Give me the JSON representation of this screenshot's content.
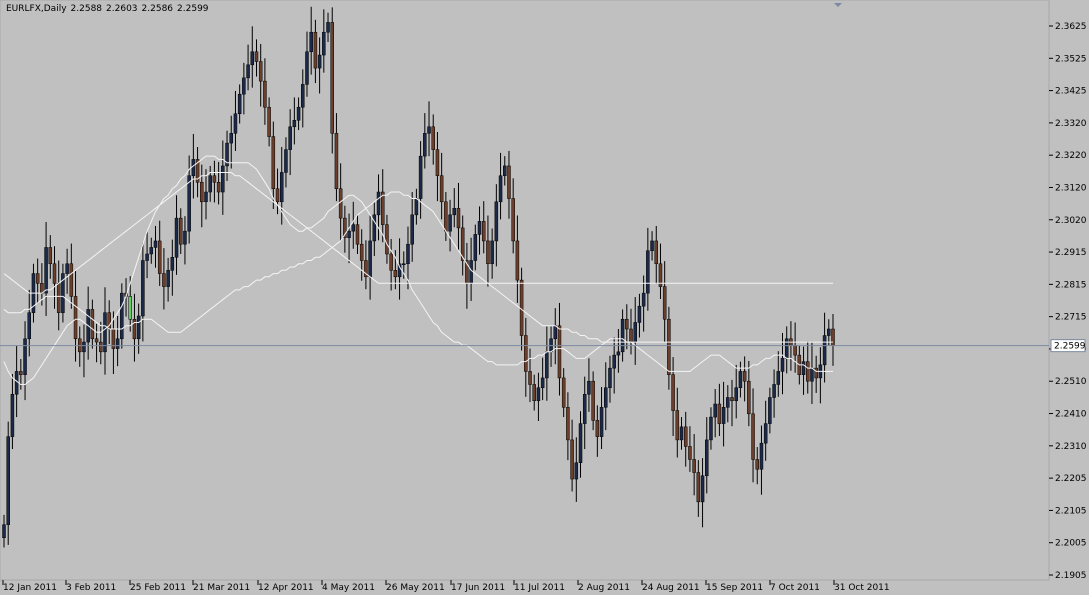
{
  "header": {
    "symbol": "EURLFX,Daily",
    "ohlc": [
      "2.2588",
      "2.2603",
      "2.2586",
      "2.2599"
    ]
  },
  "colors": {
    "background": "#c0c0c0",
    "bull_body": "#1c2a4a",
    "bear_body": "#6b3f2b",
    "wick": "#000000",
    "moving_average": "#f4f4f4",
    "price_line": "#7b8aa0",
    "highlight_candle": "#5ad45a"
  },
  "chart_data": {
    "type": "candlestick",
    "title": "EURLFX,Daily",
    "current_price": 2.2599,
    "current_price_label": "2.2599",
    "ylim": [
      2.1905,
      2.3625
    ],
    "y_ticks": [
      "2.3625",
      "2.3525",
      "2.3425",
      "2.3320",
      "2.3220",
      "2.3120",
      "2.3020",
      "2.2915",
      "2.2815",
      "2.2715",
      "2.2610",
      "2.2510",
      "2.2410",
      "2.2310",
      "2.2205",
      "2.2105",
      "2.2005",
      "2.1905"
    ],
    "x_ticks": [
      "12 Jan 2011",
      "3 Feb 2011",
      "25 Feb 2011",
      "21 Mar 2011",
      "12 Apr 2011",
      "4 May 2011",
      "26 May 2011",
      "17 Jun 2011",
      "11 Jul 2011",
      "2 Aug 2011",
      "24 Aug 2011",
      "15 Sep 2011",
      "7 Oct 2011",
      "31 Oct 2011"
    ],
    "grid": false,
    "closes": [
      2.205,
      2.232,
      2.245,
      2.252,
      2.251,
      2.262,
      2.27,
      2.282,
      2.279,
      2.276,
      2.29,
      2.285,
      2.279,
      2.27,
      2.282,
      2.285,
      2.275,
      2.262,
      2.258,
      2.261,
      2.271,
      2.262,
      2.261,
      2.258,
      2.27,
      2.265,
      2.259,
      2.262,
      2.276,
      2.275,
      2.268,
      2.262,
      2.269,
      2.286,
      2.288,
      2.29,
      2.292,
      2.282,
      2.278,
      2.283,
      2.287,
      2.299,
      2.291,
      2.295,
      2.312,
      2.317,
      2.31,
      2.304,
      2.307,
      2.312,
      2.31,
      2.307,
      2.315,
      2.322,
      2.325,
      2.331,
      2.337,
      2.342,
      2.346,
      2.35,
      2.347,
      2.341,
      2.333,
      2.324,
      2.308,
      2.304,
      2.313,
      2.32,
      2.327,
      2.329,
      2.333,
      2.34,
      2.35,
      2.356,
      2.345,
      2.349,
      2.356,
      2.359,
      2.325,
      2.308,
      2.299,
      2.293,
      2.295,
      2.297,
      2.291,
      2.286,
      2.281,
      2.292,
      2.3,
      2.307,
      2.297,
      2.288,
      2.283,
      2.281,
      2.285,
      2.285,
      2.291,
      2.3,
      2.305,
      2.318,
      2.325,
      2.327,
      2.32,
      2.312,
      2.304,
      2.295,
      2.3,
      2.302,
      2.296,
      2.286,
      2.279,
      2.286,
      2.294,
      2.298,
      2.292,
      2.285,
      2.292,
      2.304,
      2.312,
      2.315,
      2.305,
      2.292,
      2.28,
      2.263,
      2.252,
      2.248,
      2.243,
      2.247,
      2.25,
      2.258,
      2.262,
      2.266,
      2.25,
      2.241,
      2.231,
      2.219,
      2.224,
      2.236,
      2.245,
      2.249,
      2.237,
      2.232,
      2.241,
      2.247,
      2.253,
      2.257,
      2.258,
      2.268,
      2.265,
      2.261,
      2.267,
      2.272,
      2.276,
      2.289,
      2.292,
      2.285,
      2.278,
      2.268,
      2.251,
      2.24,
      2.231,
      2.235,
      2.229,
      2.225,
      2.221,
      2.212,
      2.22,
      2.231,
      2.238,
      2.242,
      2.236,
      2.241,
      2.244,
      2.243,
      2.247,
      2.252,
      2.249,
      2.239,
      2.225,
      2.222,
      2.23,
      2.236,
      2.244,
      2.248,
      2.252,
      2.256,
      2.262,
      2.26,
      2.257,
      2.251,
      2.255,
      2.249,
      2.253,
      2.25,
      2.254,
      2.263,
      2.265,
      2.2599
    ],
    "ma_fast": [
      2.255,
      2.252,
      2.25,
      2.249,
      2.248,
      2.248,
      2.249,
      2.25,
      2.252,
      2.254,
      2.256,
      2.258,
      2.26,
      2.262,
      2.264,
      2.266,
      2.267,
      2.268,
      2.268,
      2.267,
      2.266,
      2.265,
      2.264,
      2.264,
      2.265,
      2.266,
      2.268,
      2.27,
      2.272,
      2.275,
      2.279,
      2.283,
      2.287,
      2.291,
      2.295,
      2.298,
      2.301,
      2.303,
      2.305,
      2.306,
      2.308,
      2.309,
      2.311,
      2.312,
      2.314,
      2.315,
      2.316,
      2.317,
      2.318,
      2.318,
      2.318,
      2.317,
      2.317,
      2.316,
      2.316,
      2.316,
      2.316,
      2.316,
      2.316,
      2.315,
      2.314,
      2.312,
      2.31,
      2.308,
      2.305,
      2.303,
      2.301,
      2.299,
      2.297,
      2.296,
      2.295,
      2.295,
      2.296,
      2.296,
      2.297,
      2.298,
      2.299,
      2.301,
      2.302,
      2.303,
      2.304,
      2.305,
      2.306,
      2.306,
      2.305,
      2.304,
      2.302,
      2.3,
      2.298,
      2.296,
      2.294,
      2.291,
      2.289,
      2.287,
      2.284,
      2.282,
      2.28,
      2.277,
      2.275,
      2.273,
      2.271,
      2.269,
      2.267,
      2.266,
      2.264,
      2.263,
      2.262,
      2.261,
      2.261,
      2.26,
      2.26,
      2.259,
      2.258,
      2.257,
      2.256,
      2.255,
      2.255,
      2.254,
      2.254,
      2.254,
      2.254,
      2.254,
      2.254,
      2.255,
      2.255,
      2.256,
      2.256,
      2.257,
      2.257,
      2.258,
      2.258,
      2.259,
      2.259,
      2.259,
      2.258,
      2.257,
      2.256,
      2.256,
      2.256,
      2.257,
      2.258,
      2.259,
      2.26,
      2.261,
      2.262,
      2.262,
      2.262,
      2.262,
      2.261,
      2.261,
      2.26,
      2.259,
      2.258,
      2.257,
      2.256,
      2.255,
      2.254,
      2.253,
      2.252,
      2.252,
      2.252,
      2.252,
      2.252,
      2.252,
      2.253,
      2.254,
      2.255,
      2.256,
      2.257,
      2.257,
      2.257,
      2.256,
      2.255,
      2.254,
      2.253,
      2.253,
      2.253,
      2.253,
      2.254,
      2.254,
      2.255,
      2.256,
      2.256,
      2.257,
      2.257,
      2.257,
      2.256,
      2.256,
      2.255,
      2.254,
      2.254,
      2.253,
      2.253,
      2.252,
      2.252,
      2.252,
      2.252,
      2.252
    ],
    "ma_slow": [
      2.282,
      2.281,
      2.28,
      2.279,
      2.278,
      2.277,
      2.276,
      2.276,
      2.276,
      2.276,
      2.277,
      2.277,
      2.278,
      2.279,
      2.28,
      2.281,
      2.282,
      2.283,
      2.284,
      2.285,
      2.286,
      2.287,
      2.288,
      2.289,
      2.29,
      2.291,
      2.292,
      2.293,
      2.294,
      2.295,
      2.296,
      2.297,
      2.298,
      2.299,
      2.3,
      2.301,
      2.302,
      2.303,
      2.304,
      2.305,
      2.306,
      2.307,
      2.308,
      2.309,
      2.31,
      2.311,
      2.311,
      2.312,
      2.312,
      2.313,
      2.313,
      2.313,
      2.313,
      2.313,
      2.313,
      2.312,
      2.312,
      2.311,
      2.31,
      2.309,
      2.308,
      2.307,
      2.306,
      2.305,
      2.304,
      2.303,
      2.302,
      2.301,
      2.3,
      2.299,
      2.298,
      2.297,
      2.296,
      2.295,
      2.294,
      2.293,
      2.292,
      2.291,
      2.29,
      2.289,
      2.288,
      2.287,
      2.286,
      2.285,
      2.284,
      2.283,
      2.282,
      2.281,
      2.28,
      2.279,
      2.279,
      2.279,
      2.279,
      2.279,
      2.279,
      2.279,
      2.279,
      2.279,
      2.279,
      2.279,
      2.279,
      2.279,
      2.279,
      2.279,
      2.279,
      2.279,
      2.279,
      2.279,
      2.279,
      2.279,
      2.279,
      2.279,
      2.279,
      2.279,
      2.279,
      2.279,
      2.279,
      2.279,
      2.279,
      2.279,
      2.279,
      2.279,
      2.279,
      2.279,
      2.279,
      2.279,
      2.279,
      2.279,
      2.279,
      2.279,
      2.279,
      2.279,
      2.279,
      2.279,
      2.279,
      2.279,
      2.279,
      2.279,
      2.279,
      2.279,
      2.279,
      2.279,
      2.279,
      2.279,
      2.279,
      2.279,
      2.279,
      2.279,
      2.279,
      2.279,
      2.279,
      2.279,
      2.279,
      2.279,
      2.279,
      2.279,
      2.279,
      2.279,
      2.279,
      2.279,
      2.279,
      2.279,
      2.279,
      2.279,
      2.279,
      2.279,
      2.279,
      2.279,
      2.279,
      2.279,
      2.279,
      2.279,
      2.279,
      2.279,
      2.279,
      2.279,
      2.279,
      2.279,
      2.279,
      2.279,
      2.279,
      2.279,
      2.279,
      2.279,
      2.279,
      2.279,
      2.279,
      2.279,
      2.279,
      2.279,
      2.279,
      2.279,
      2.279,
      2.279,
      2.279,
      2.279,
      2.279,
      2.279
    ],
    "ma_mid": [
      2.271,
      2.27,
      2.27,
      2.27,
      2.27,
      2.271,
      2.271,
      2.272,
      2.273,
      2.274,
      2.275,
      2.275,
      2.275,
      2.275,
      2.275,
      2.274,
      2.273,
      2.272,
      2.271,
      2.27,
      2.269,
      2.268,
      2.267,
      2.266,
      2.266,
      2.265,
      2.265,
      2.265,
      2.265,
      2.266,
      2.266,
      2.267,
      2.267,
      2.268,
      2.268,
      2.268,
      2.267,
      2.266,
      2.265,
      2.264,
      2.264,
      2.264,
      2.264,
      2.265,
      2.266,
      2.267,
      2.268,
      2.269,
      2.27,
      2.271,
      2.272,
      2.273,
      2.274,
      2.275,
      2.276,
      2.277,
      2.277,
      2.278,
      2.278,
      2.279,
      2.28,
      2.28,
      2.281,
      2.281,
      2.282,
      2.282,
      2.283,
      2.283,
      2.284,
      2.284,
      2.285,
      2.285,
      2.286,
      2.286,
      2.287,
      2.287,
      2.288,
      2.289,
      2.29,
      2.291,
      2.292,
      2.294,
      2.296,
      2.298,
      2.3,
      2.301,
      2.302,
      2.303,
      2.304,
      2.305,
      2.306,
      2.306,
      2.307,
      2.307,
      2.307,
      2.306,
      2.306,
      2.305,
      2.305,
      2.304,
      2.303,
      2.302,
      2.301,
      2.299,
      2.297,
      2.295,
      2.293,
      2.291,
      2.289,
      2.287,
      2.285,
      2.283,
      2.282,
      2.281,
      2.28,
      2.279,
      2.278,
      2.277,
      2.276,
      2.275,
      2.274,
      2.273,
      2.272,
      2.271,
      2.27,
      2.269,
      2.268,
      2.267,
      2.266,
      2.266,
      2.266,
      2.266,
      2.265,
      2.265,
      2.265,
      2.264,
      2.264,
      2.263,
      2.263,
      2.262,
      2.262,
      2.262,
      2.261,
      2.261,
      2.261,
      2.261,
      2.261,
      2.261,
      2.261,
      2.261,
      2.261,
      2.261,
      2.261,
      2.261,
      2.261,
      2.261,
      2.261,
      2.261,
      2.261,
      2.261,
      2.261,
      2.261,
      2.261,
      2.261,
      2.261,
      2.261,
      2.261,
      2.261,
      2.261,
      2.261,
      2.261,
      2.261,
      2.261,
      2.261,
      2.261,
      2.261,
      2.261,
      2.261,
      2.261,
      2.261,
      2.261,
      2.261,
      2.261,
      2.261,
      2.261,
      2.261,
      2.261,
      2.261,
      2.261,
      2.261,
      2.261,
      2.261,
      2.261,
      2.261,
      2.261,
      2.261,
      2.261,
      2.261
    ]
  }
}
